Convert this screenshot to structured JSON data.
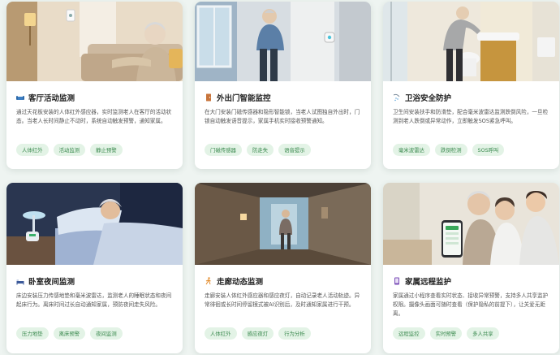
{
  "colors": {
    "accent": "#3b8a4f",
    "tag_bg": "#e3f3e6",
    "page_bg": "#eef4f1"
  },
  "cards": [
    {
      "title": "客厅活动监测",
      "icon": "couch-icon",
      "desc": "通过天花板安装的人体红外感应器，实时监测老人在客厅的活动状态。当老人长时间静止不动时，系统自动触发预警，通知家属。",
      "tags": [
        "人体红外",
        "活动监测",
        "静止预警"
      ]
    },
    {
      "title": "外出门智能监控",
      "icon": "door-icon",
      "desc": "在大门安装门磁传感器和隐形智能锁，当老人试图独自外出时，门锁自动触发语音提示，家属手机实时接收预警通知。",
      "tags": [
        "门磁传感器",
        "防走失",
        "语音提示"
      ]
    },
    {
      "title": "卫浴安全防护",
      "icon": "shower-icon",
      "desc": "卫生间安装扶手和防滑垫，配合毫米波雷达监测跌倒风险，一旦检测到老人跌倒或异常动作，立即触发SOS紧急呼叫。",
      "tags": [
        "毫米波雷达",
        "跌倒检测",
        "SOS呼叫"
      ]
    },
    {
      "title": "卧室夜间监测",
      "icon": "bed-icon",
      "desc": "床边安装压力传感地垫和毫米波雷达，监测老人的睡眠状态和夜间起床行为。离床时间过长自动通知家属，预防夜间走失风险。",
      "tags": [
        "压力地垫",
        "离床预警",
        "夜间监测"
      ]
    },
    {
      "title": "走廊动态监测",
      "icon": "walking-icon",
      "desc": "走廊安装人体红外感应器和感应夜灯，自动记录老人活动轨迹。异常徘徊或长时间停留模式被AI识别后，及时通知家属进行干预。",
      "tags": [
        "人体红外",
        "感应夜灯",
        "行为分析"
      ]
    },
    {
      "title": "家属远程监护",
      "icon": "phone-icon",
      "desc": "家属通过小程序查看实时状态、接收异常预警，支持多人共享监护权限。摄像头画面可随时查看（保护隐私的前提下），让关爱无距离。",
      "tags": [
        "远程监控",
        "实时预警",
        "多人共享"
      ]
    }
  ]
}
